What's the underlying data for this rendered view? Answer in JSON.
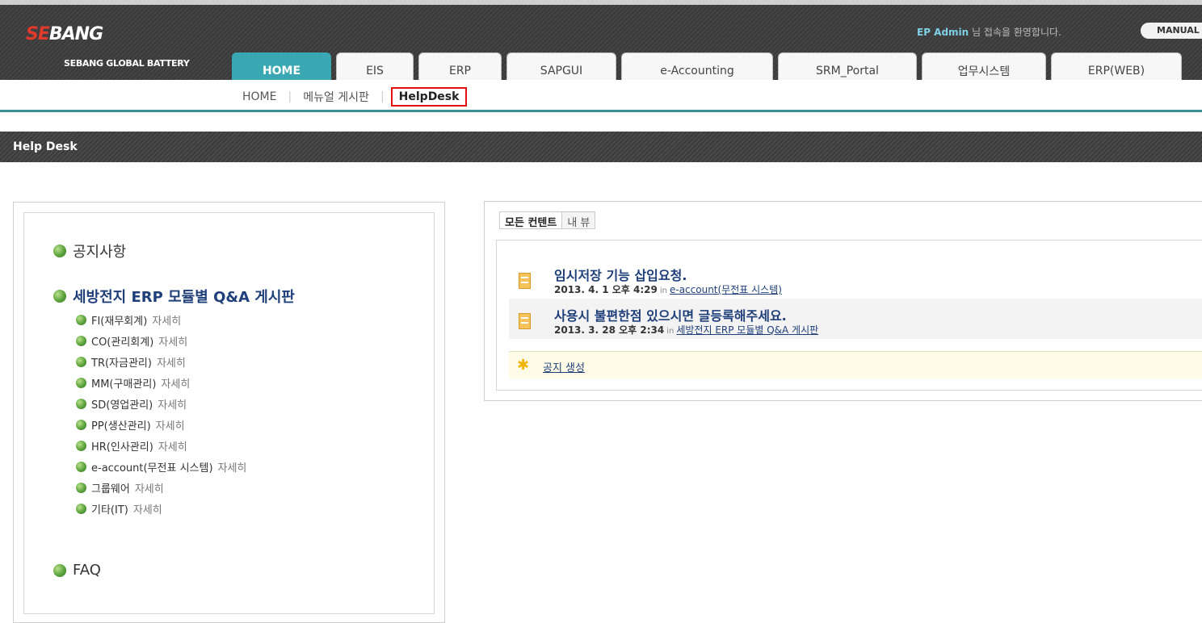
{
  "header": {
    "logo_main": "SEBANG",
    "logo_sub": "SEBANG GLOBAL BATTERY",
    "welcome_name": "EP Admin",
    "welcome_text": "님 접속을 환영합니다.",
    "manual_label": "MANUAL"
  },
  "tabs": [
    {
      "label": "HOME",
      "active": true
    },
    {
      "label": "EIS"
    },
    {
      "label": "ERP"
    },
    {
      "label": "SAPGUI"
    },
    {
      "label": "e-Accounting"
    },
    {
      "label": "SRM_Portal"
    },
    {
      "label": "업무시스템"
    },
    {
      "label": "ERP(WEB)"
    }
  ],
  "subnav": {
    "items": [
      "HOME",
      "메뉴얼 게시판",
      "HelpDesk"
    ]
  },
  "page_title": "Help Desk",
  "left": {
    "notice": "공지사항",
    "qa_board": "세방전지 ERP 모듈별 Q&A 게시판",
    "modules": [
      {
        "name": "FI(재무회계)",
        "more": "자세히"
      },
      {
        "name": "CO(관리회계)",
        "more": "자세히"
      },
      {
        "name": "TR(자금관리)",
        "more": "자세히"
      },
      {
        "name": "MM(구매관리)",
        "more": "자세히"
      },
      {
        "name": "SD(영업관리)",
        "more": "자세히"
      },
      {
        "name": "PP(생산관리)",
        "more": "자세히"
      },
      {
        "name": "HR(인사관리)",
        "more": "자세히"
      },
      {
        "name": "e-account(무전표 시스템)",
        "more": "자세히"
      },
      {
        "name": "그룹웨어",
        "more": "자세히"
      },
      {
        "name": "기타(IT)",
        "more": "자세히"
      }
    ],
    "faq": "FAQ"
  },
  "right": {
    "view_tabs": [
      "모든 컨텐트",
      "내 뷰"
    ],
    "posts": [
      {
        "title": "임시저장 기능 삽입요청.",
        "date": "2013. 4. 1 오후 4:29",
        "in": "in",
        "source": "e-account(무전표 시스템)"
      },
      {
        "title": "사용시 불편한점 있으시면 글등록해주세요.",
        "date": "2013. 3. 28 오후 2:34",
        "in": "in",
        "source": "세방전지 ERP 모듈별 Q&A 게시판"
      }
    ],
    "create_link": "공지 생성"
  }
}
